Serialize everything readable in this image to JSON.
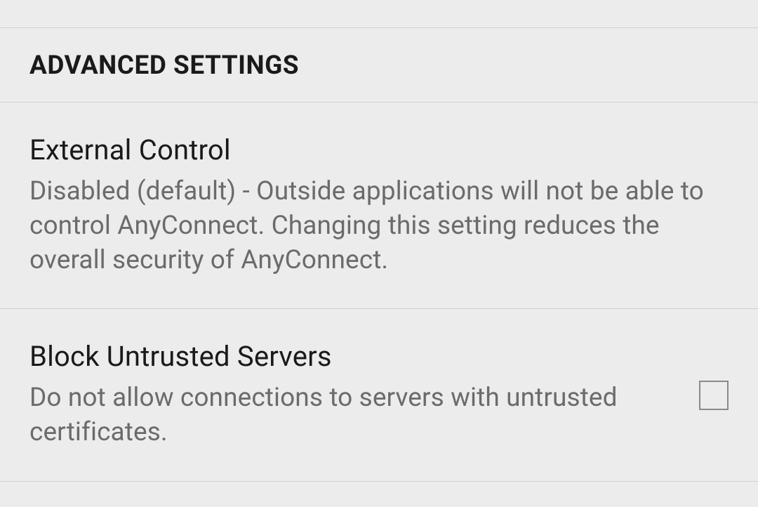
{
  "section": {
    "header": "ADVANCED SETTINGS",
    "items": [
      {
        "title": "External Control",
        "description": "Disabled (default) - Outside applications will not be able to control AnyConnect. Changing this setting reduces the overall security of AnyConnect."
      },
      {
        "title": "Block Untrusted Servers",
        "description": "Do not allow connections to servers with untrusted certificates.",
        "checked": false
      }
    ]
  }
}
